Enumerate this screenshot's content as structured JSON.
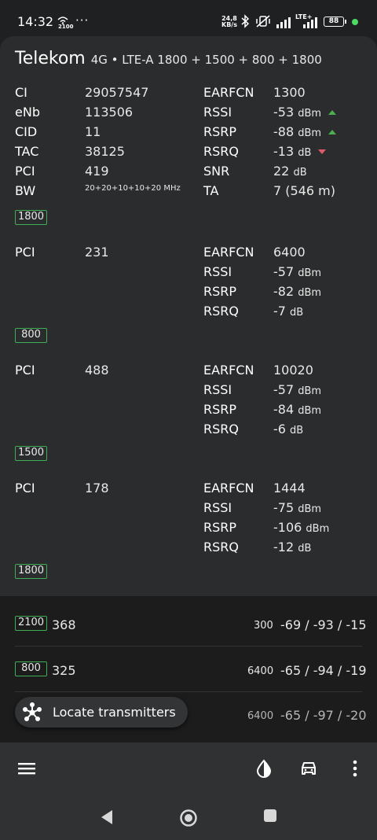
{
  "status_bar": {
    "time": "14:32",
    "wifi_label": "2100",
    "more": "···",
    "speed_value": "24,8",
    "speed_unit": "KB/s",
    "network_label": "LTE+",
    "battery": "88"
  },
  "serving": {
    "operator": "Telekom",
    "tech": "4G • LTE-A 1800 + 1500 + 800 + 1800",
    "left": [
      {
        "label": "CI",
        "value": "29057547"
      },
      {
        "label": "eNb",
        "value": "113506"
      },
      {
        "label": "CID",
        "value": "11"
      },
      {
        "label": "TAC",
        "value": "38125"
      },
      {
        "label": "PCI",
        "value": "419"
      },
      {
        "label": "BW",
        "value": "20+20+10+10+20 MHz"
      }
    ],
    "right": [
      {
        "label": "EARFCN",
        "value": "1300",
        "unit": ""
      },
      {
        "label": "RSSI",
        "value": "-53",
        "unit": "dBm",
        "trend": "up"
      },
      {
        "label": "RSRP",
        "value": "-88",
        "unit": "dBm",
        "trend": "up"
      },
      {
        "label": "RSRQ",
        "value": "-13",
        "unit": "dB",
        "trend": "down"
      },
      {
        "label": "SNR",
        "value": "22",
        "unit": "dB"
      },
      {
        "label": "TA",
        "value": "7 (546 m)",
        "unit": ""
      }
    ],
    "band": "1800"
  },
  "carriers": [
    {
      "pci_label": "PCI",
      "pci": "231",
      "earfcn_label": "EARFCN",
      "earfcn": "6400",
      "rssi_label": "RSSI",
      "rssi": "-57",
      "rsrp_label": "RSRP",
      "rsrp": "-82",
      "rsrq_label": "RSRQ",
      "rsrq": "-7",
      "band": "800"
    },
    {
      "pci_label": "PCI",
      "pci": "488",
      "earfcn_label": "EARFCN",
      "earfcn": "10020",
      "rssi_label": "RSSI",
      "rssi": "-57",
      "rsrp_label": "RSRP",
      "rsrp": "-84",
      "rsrq_label": "RSRQ",
      "rsrq": "-6",
      "band": "1500"
    },
    {
      "pci_label": "PCI",
      "pci": "178",
      "earfcn_label": "EARFCN",
      "earfcn": "1444",
      "rssi_label": "RSSI",
      "rssi": "-75",
      "rsrp_label": "RSRP",
      "rsrp": "-106",
      "rsrq_label": "RSRQ",
      "rsrq": "-12",
      "band": "1800"
    }
  ],
  "units": {
    "dbm": "dBm",
    "db": "dB"
  },
  "neighbors": [
    {
      "band": "2100",
      "pci": "368",
      "earfcn": "300",
      "signal": "-69 / -93 / -15"
    },
    {
      "band": "800",
      "pci": "325",
      "earfcn": "6400",
      "signal": "-65 / -94 / -19"
    },
    {
      "band": "",
      "pci": "",
      "earfcn": "6400",
      "signal": "-65 / -97 / -20"
    }
  ],
  "fab": {
    "label": "Locate transmitters"
  },
  "colors": {
    "band_border": "#3fae54",
    "trend_up": "#4caf50",
    "trend_down": "#e05a6b",
    "status_dot": "#4cd964"
  }
}
